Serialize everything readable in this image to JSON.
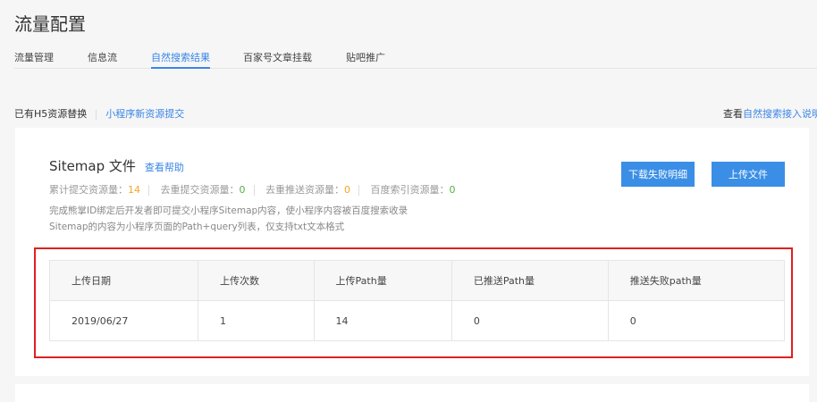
{
  "page_title": "流量配置",
  "tabs": [
    "流量管理",
    "信息流",
    "自然搜索结果",
    "百家号文章挂载",
    "贴吧推广"
  ],
  "subnav": {
    "item1": "已有H5资源替换",
    "item2": "小程序新资源提交"
  },
  "help_right": {
    "prefix": "查看",
    "link": "自然搜索接入说明"
  },
  "sitemap": {
    "title": "Sitemap 文件",
    "help": "查看帮助",
    "stats": [
      {
        "label": "累计提交资源量：",
        "value": "14"
      },
      {
        "label": "去重提交资源量：",
        "value": "0"
      },
      {
        "label": "去重推送资源量：",
        "value": "0"
      },
      {
        "label": "百度索引资源量：",
        "value": "0"
      }
    ],
    "desc1": "完成熊掌ID绑定后开发者即可提交小程序Sitemap内容，使小程序内容被百度搜索收录",
    "desc2": "Sitemap的内容为小程序页面的Path+query列表，仅支持txt文本格式",
    "download_btn": "下载失败明细",
    "upload_btn": "上传文件"
  },
  "table": {
    "headers": [
      "上传日期",
      "上传次数",
      "上传Path量",
      "已推送Path量",
      "推送失败path量"
    ],
    "rows": [
      [
        "2019/06/27",
        "1",
        "14",
        "0",
        "0"
      ]
    ]
  }
}
